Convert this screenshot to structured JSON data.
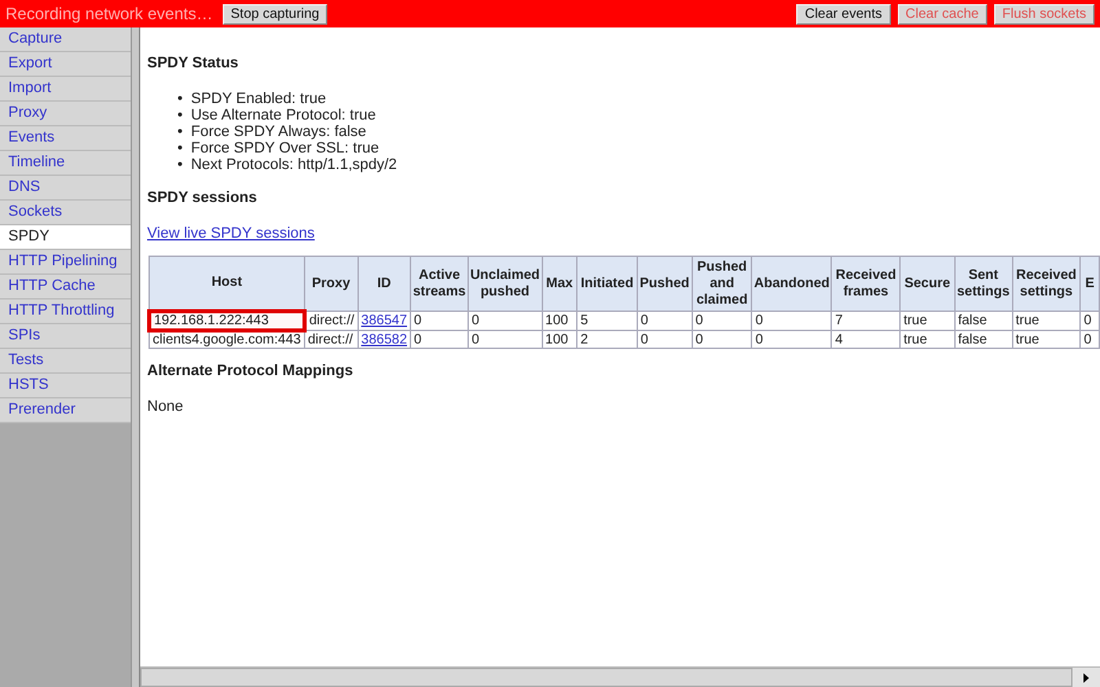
{
  "top_bar": {
    "status": "Recording network events…",
    "buttons": [
      {
        "label": "Stop capturing",
        "kind": "normal"
      },
      {
        "label": "Clear events",
        "kind": "normal"
      },
      {
        "label": "Clear cache",
        "kind": "danger"
      },
      {
        "label": "Flush sockets",
        "kind": "danger"
      }
    ]
  },
  "sidebar": {
    "items": [
      {
        "label": "Capture",
        "selected": false
      },
      {
        "label": "Export",
        "selected": false
      },
      {
        "label": "Import",
        "selected": false
      },
      {
        "label": "Proxy",
        "selected": false
      },
      {
        "label": "Events",
        "selected": false
      },
      {
        "label": "Timeline",
        "selected": false
      },
      {
        "label": "DNS",
        "selected": false
      },
      {
        "label": "Sockets",
        "selected": false
      },
      {
        "label": "SPDY",
        "selected": true
      },
      {
        "label": "HTTP Pipelining",
        "selected": false
      },
      {
        "label": "HTTP Cache",
        "selected": false
      },
      {
        "label": "HTTP Throttling",
        "selected": false
      },
      {
        "label": "SPIs",
        "selected": false
      },
      {
        "label": "Tests",
        "selected": false
      },
      {
        "label": "HSTS",
        "selected": false
      },
      {
        "label": "Prerender",
        "selected": false
      }
    ]
  },
  "spdy_status": {
    "title": "SPDY Status",
    "bullet": "•",
    "items": [
      "SPDY Enabled: true",
      "Use Alternate Protocol: true",
      "Force SPDY Always: false",
      "Force SPDY Over SSL: true",
      "Next Protocols: http/1.1,spdy/2"
    ]
  },
  "spdy_sessions": {
    "title": "SPDY sessions",
    "link": "View live SPDY sessions",
    "table": {
      "columns": [
        "Host",
        "Proxy",
        "ID",
        "Active streams",
        "Unclaimed pushed",
        "Max",
        "Initiated",
        "Pushed",
        "Pushed and claimed",
        "Abandoned",
        "Received frames",
        "Secure",
        "Sent settings",
        "Received settings",
        "E"
      ],
      "rows": [
        {
          "highlighted": true,
          "cells": [
            "192.168.1.222:443",
            "direct://",
            "386547",
            "0",
            "0",
            "100",
            "5",
            "0",
            "0",
            "0",
            "7",
            "true",
            "false",
            "true",
            "0"
          ]
        },
        {
          "highlighted": false,
          "cells": [
            "clients4.google.com:443",
            "direct://",
            "386582",
            "0",
            "0",
            "100",
            "2",
            "0",
            "0",
            "0",
            "4",
            "true",
            "false",
            "true",
            "0"
          ]
        }
      ]
    }
  },
  "alternate_protocol": {
    "title": "Alternate Protocol Mappings",
    "text": "None"
  }
}
